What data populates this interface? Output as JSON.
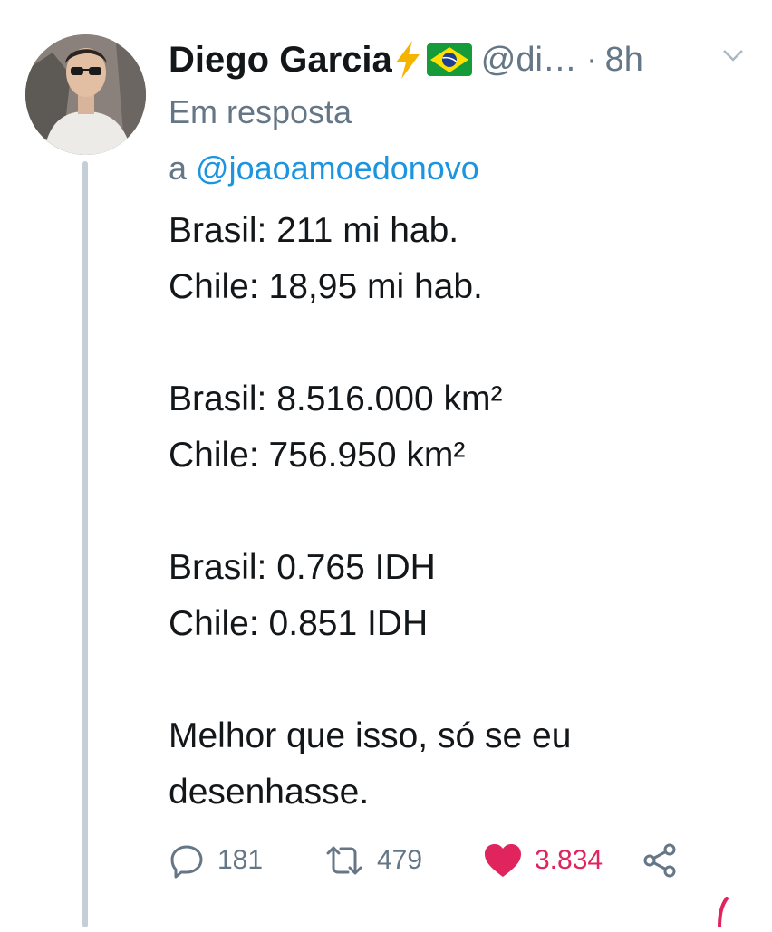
{
  "tweet": {
    "display_name": "Diego Garcia",
    "handle": "@di…",
    "separator": "·",
    "time": "8h",
    "reply_prefix": "Em resposta",
    "reply_to_prefix": "a",
    "reply_to": "@joaoamoedonovo",
    "body": "Brasil: 211 mi hab.\nChile: 18,95 mi hab.\n\nBrasil: 8.516.000 km²\nChile: 756.950 km²\n\nBrasil: 0.765 IDH\nChile: 0.851 IDH\n\nMelhor que isso, só se eu\ndesenhasse."
  },
  "actions": {
    "replies": "181",
    "retweets": "479",
    "likes": "3.834"
  },
  "icons": {
    "name_emoji_1": "high-voltage-icon",
    "name_emoji_2": "brazil-flag-icon",
    "menu": "chevron-down-icon",
    "reply": "reply-icon",
    "retweet": "retweet-icon",
    "like": "heart-icon",
    "share": "share-icon"
  },
  "colors": {
    "text": "#14171a",
    "secondary": "#657786",
    "link": "#1b95e0",
    "like": "#e0245e",
    "thread_line": "#c5cdd6"
  }
}
